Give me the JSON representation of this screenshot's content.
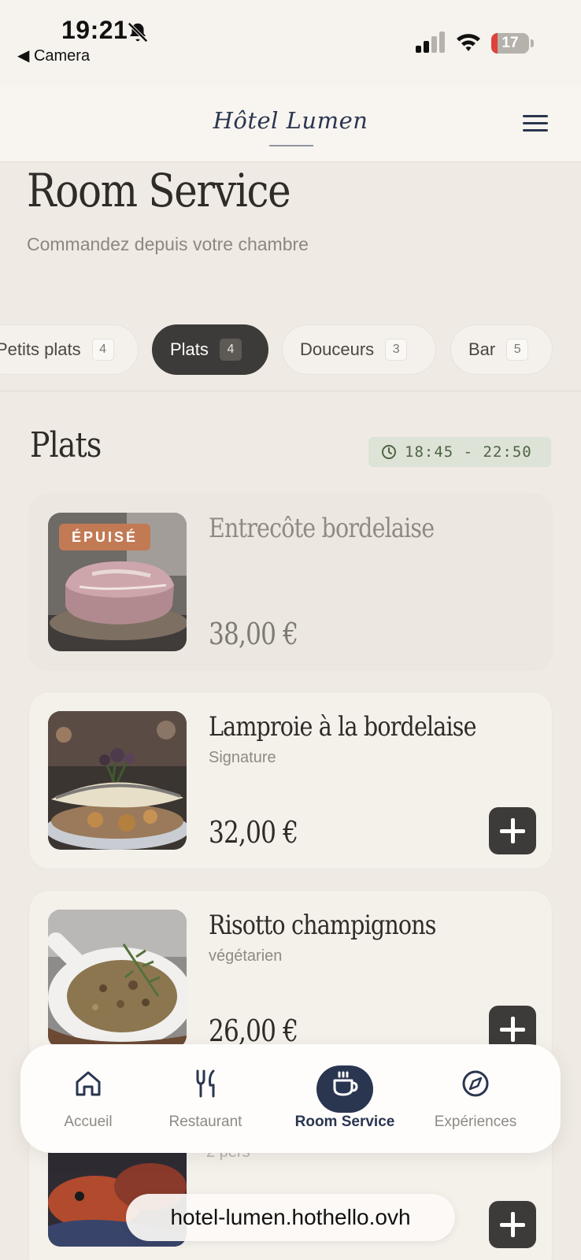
{
  "status": {
    "time": "19:21",
    "back_label": "◀ Camera",
    "battery_level": "17"
  },
  "header": {
    "brand": "Hôtel Lumen"
  },
  "page": {
    "title": "Room Service",
    "subtitle": "Commandez depuis votre chambre"
  },
  "tabs": [
    {
      "label": "Petits plats",
      "count": "4"
    },
    {
      "label": "Plats",
      "count": "4"
    },
    {
      "label": "Douceurs",
      "count": "3"
    },
    {
      "label": "Bar",
      "count": "5"
    }
  ],
  "section": {
    "title": "Plats",
    "hours": "18:45 - 22:50"
  },
  "dishes": [
    {
      "name": "Entrecôte bordelaise",
      "tag": "",
      "price": "38,00 €",
      "badge": "ÉPUISÉ"
    },
    {
      "name": "Lamproie à la bordelaise",
      "tag": "Signature",
      "price": "32,00 €"
    },
    {
      "name": "Risotto champignons",
      "tag": "végétarien",
      "price": "26,00 €"
    },
    {
      "name": "",
      "tag": "2 pers",
      "price": ""
    }
  ],
  "nav": [
    {
      "label": "Accueil",
      "icon": "home-icon"
    },
    {
      "label": "Restaurant",
      "icon": "fork-knife-icon"
    },
    {
      "label": "Room Service",
      "icon": "cup-icon"
    },
    {
      "label": "Expériences",
      "icon": "compass-icon"
    }
  ],
  "browser": {
    "url": "hotel-lumen.hothello.ovh"
  },
  "colors": {
    "background": "#efebe4",
    "accent_navy": "#2a3550",
    "active_tab": "#3d3b39",
    "sold_out_badge": "#c27a55",
    "hours_bg": "#dde3d6"
  }
}
